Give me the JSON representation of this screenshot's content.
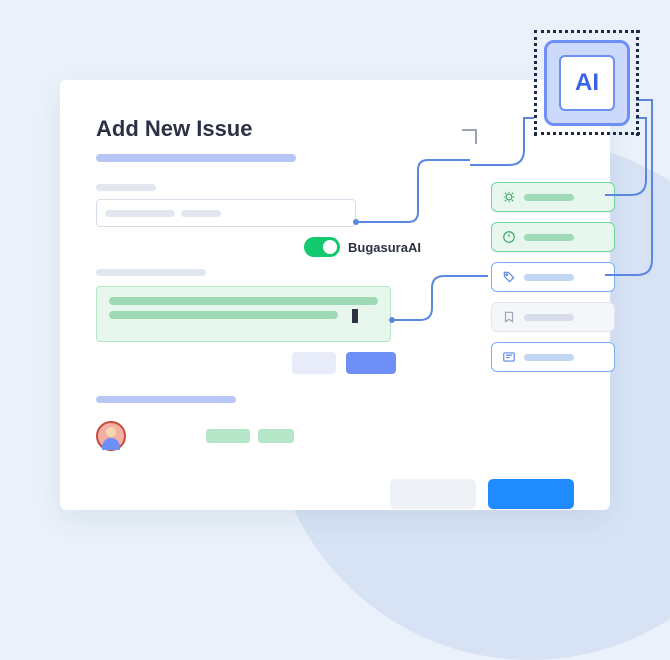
{
  "page": {
    "title": "Add New Issue"
  },
  "toggle": {
    "label": "BugasuraAI",
    "on": true
  },
  "ai_chip": {
    "label": "AI"
  },
  "suggestions": [
    {
      "icon": "bug-icon",
      "style": "green"
    },
    {
      "icon": "alert-circle-icon",
      "style": "green"
    },
    {
      "icon": "tag-icon",
      "style": "blue"
    },
    {
      "icon": "bookmark-icon",
      "style": "gray"
    },
    {
      "icon": "list-icon",
      "style": "blue"
    }
  ],
  "colors": {
    "accent_blue": "#1f8bff",
    "accent_indigo": "#6e8ff5",
    "accent_green": "#13c96f",
    "soft_green": "#e8f7ee"
  }
}
